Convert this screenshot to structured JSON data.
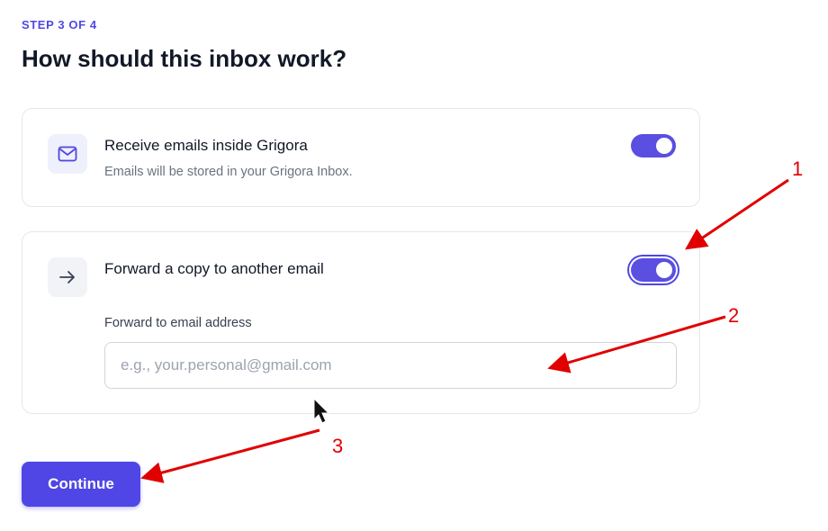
{
  "step_label": "STEP 3 OF 4",
  "page_title": "How should this inbox work?",
  "options": [
    {
      "icon": "mail-icon",
      "title": "Receive emails inside Grigora",
      "description": "Emails will be stored in your Grigora Inbox.",
      "enabled": true
    },
    {
      "icon": "arrow-right-icon",
      "title": "Forward a copy to another email",
      "enabled": true,
      "field_label": "Forward to email address",
      "field_value": "",
      "field_placeholder": "e.g., your.personal@gmail.com"
    }
  ],
  "continue_label": "Continue",
  "annotations": {
    "marker_1": "1",
    "marker_2": "2",
    "marker_3": "3",
    "color": "#e00000"
  },
  "colors": {
    "accent": "#4f46e5",
    "step_label": "#5048e5"
  }
}
